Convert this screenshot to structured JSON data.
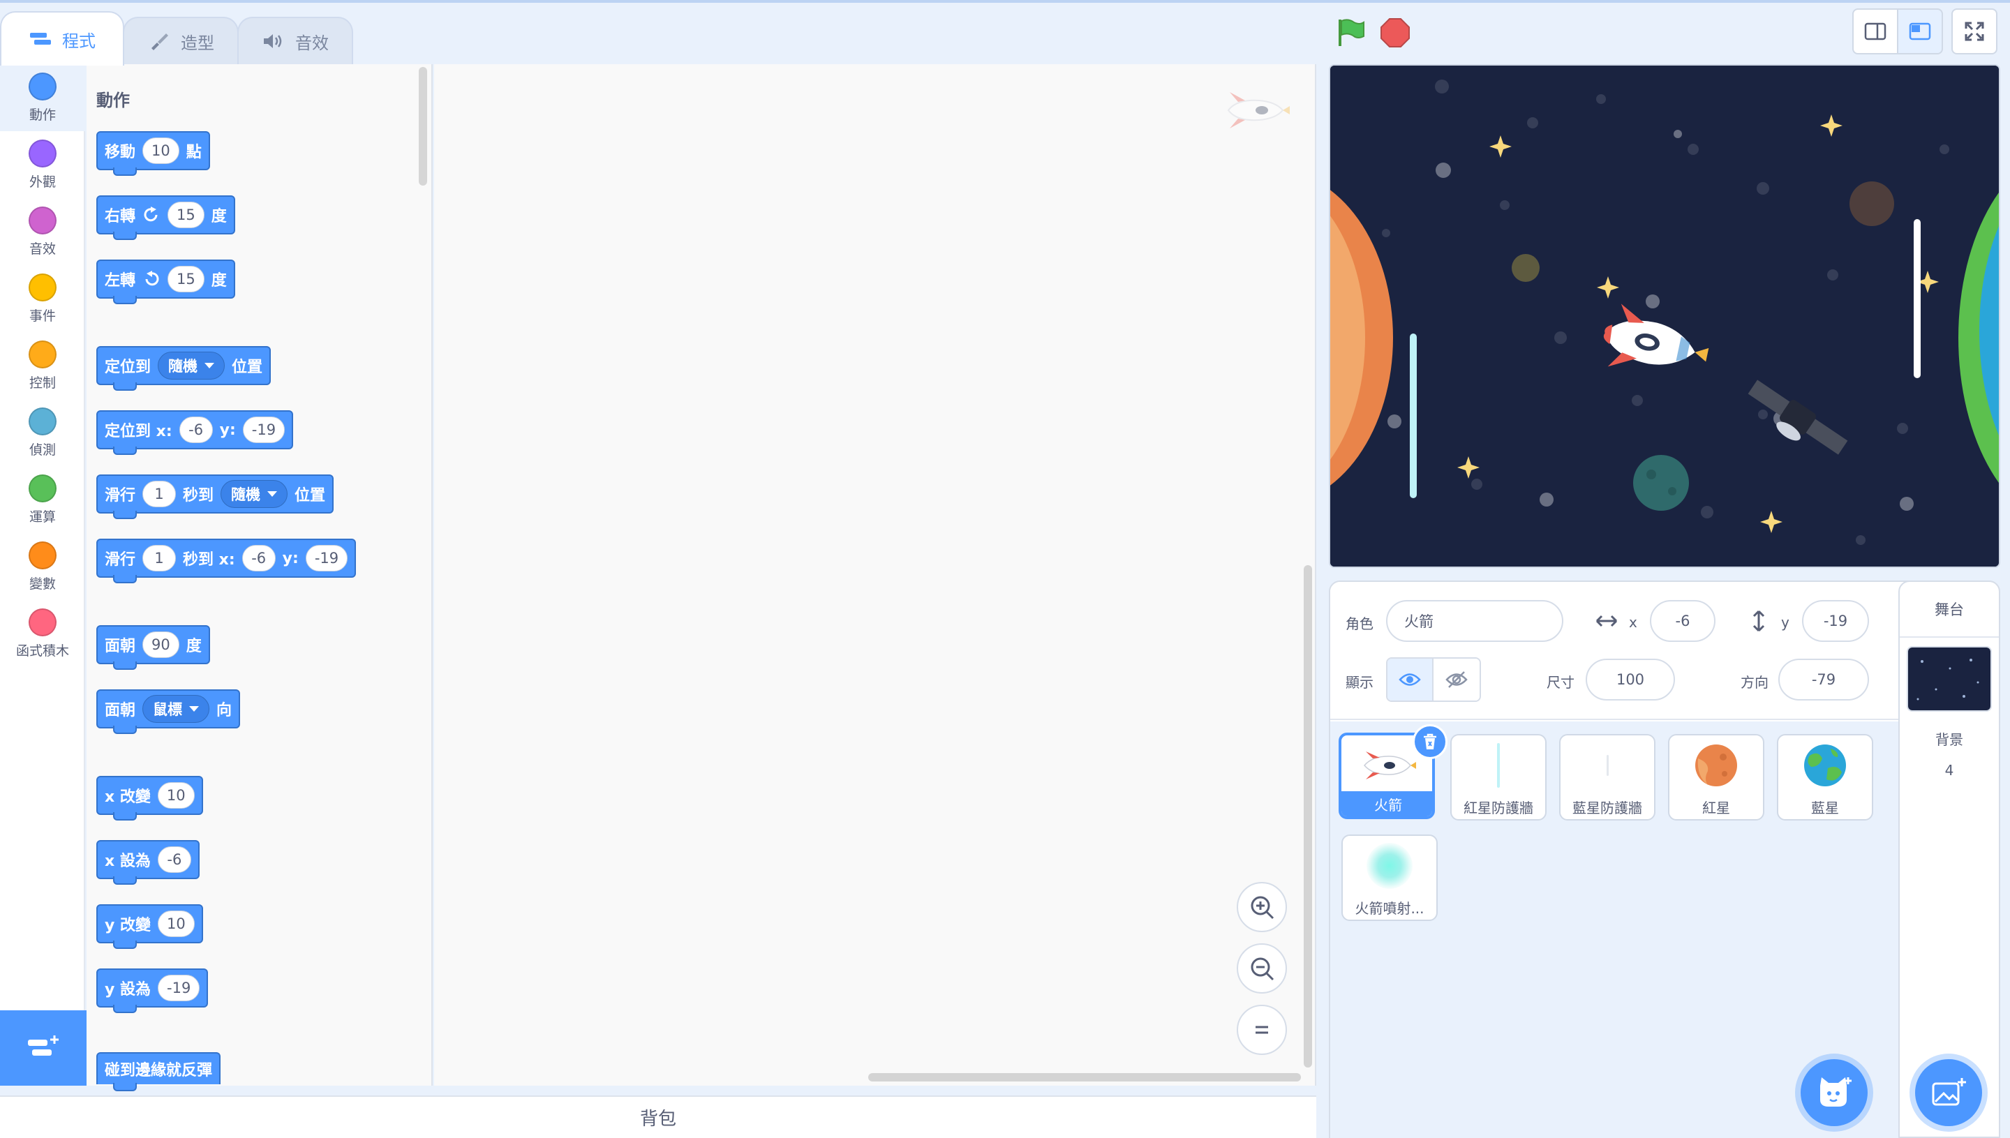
{
  "tabs": {
    "code": "程式",
    "costumes": "造型",
    "sounds": "音效"
  },
  "categories": [
    {
      "label": "動作",
      "color": "#4c97ff"
    },
    {
      "label": "外觀",
      "color": "#9966ff"
    },
    {
      "label": "音效",
      "color": "#cf63cf"
    },
    {
      "label": "事件",
      "color": "#ffbf00"
    },
    {
      "label": "控制",
      "color": "#ffab19"
    },
    {
      "label": "偵測",
      "color": "#5cb1d6"
    },
    {
      "label": "運算",
      "color": "#59c059"
    },
    {
      "label": "變數",
      "color": "#ff8c1a"
    },
    {
      "label": "函式積木",
      "color": "#ff6680"
    }
  ],
  "palette": {
    "title": "動作",
    "move": {
      "a": "移動",
      "v": "10",
      "b": "點"
    },
    "turn_right": {
      "a": "右轉",
      "v": "15",
      "b": "度"
    },
    "turn_left": {
      "a": "左轉",
      "v": "15",
      "b": "度"
    },
    "goto": {
      "a": "定位到",
      "dd": "隨機",
      "b": "位置"
    },
    "goto_xy": {
      "a": "定位到 x:",
      "x": "-6",
      "yl": "y:",
      "y": "-19"
    },
    "glide": {
      "a": "滑行",
      "v": "1",
      "b": "秒到",
      "dd": "隨機",
      "c": "位置"
    },
    "glide_xy": {
      "a": "滑行",
      "v": "1",
      "b": "秒到 x:",
      "x": "-6",
      "yl": "y:",
      "y": "-19"
    },
    "point_dir": {
      "a": "面朝",
      "v": "90",
      "b": "度"
    },
    "point_towards": {
      "a": "面朝",
      "dd": "鼠標",
      "b": "向"
    },
    "change_x": {
      "a": "x 改變",
      "v": "10"
    },
    "set_x": {
      "a": "x 設為",
      "v": "-6"
    },
    "change_y": {
      "a": "y 改變",
      "v": "10"
    },
    "set_y": {
      "a": "y 設為",
      "v": "-19"
    },
    "bounce": {
      "a": "碰到邊緣就反彈"
    }
  },
  "backpack": "背包",
  "sprite_info": {
    "sprite_label": "角色",
    "sprite_name": "火箭",
    "x_label": "x",
    "x": "-6",
    "y_label": "y",
    "y": "-19",
    "show_label": "顯示",
    "size_label": "尺寸",
    "size": "100",
    "direction_label": "方向",
    "direction": "-79"
  },
  "sprites": [
    {
      "name": "火箭",
      "selected": true
    },
    {
      "name": "紅星防護牆"
    },
    {
      "name": "藍星防護牆"
    },
    {
      "name": "紅星"
    },
    {
      "name": "藍星"
    },
    {
      "name": "火箭噴射..."
    }
  ],
  "stage_panel": {
    "title": "舞台",
    "backdrop_label": "背景",
    "backdrop_count": "4"
  },
  "colors": {
    "accent": "#4c97ff",
    "flag": "#4cbf56",
    "stop": "#ec5959",
    "space": "#1a2340"
  }
}
